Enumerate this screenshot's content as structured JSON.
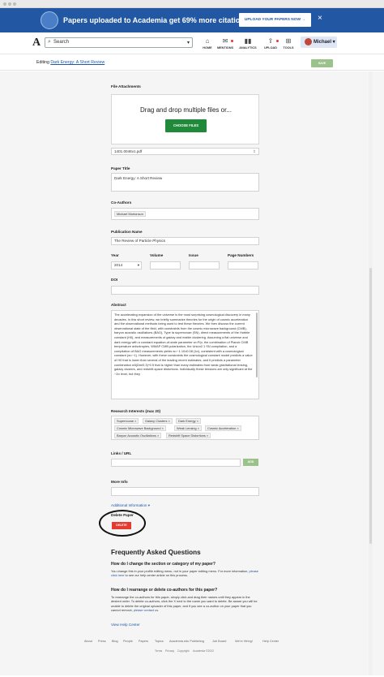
{
  "banner": {
    "message": "Papers uploaded to Academia get 69% more citations.",
    "upload_button": "UPLOAD YOUR PAPERS NOW →",
    "close": "×"
  },
  "nav": {
    "brand": "A",
    "search_placeholder": "Search",
    "items": [
      {
        "label": "HOME",
        "icon": "⌂"
      },
      {
        "label": "MENTIONS",
        "icon": "✉"
      },
      {
        "label": "ANALYTICS",
        "icon": "▮▮"
      },
      {
        "label": "UPLOAD",
        "icon": "⇪"
      },
      {
        "label": "TOOLS",
        "icon": "⊞"
      }
    ],
    "user": "Michael ▾"
  },
  "editbar": {
    "prefix": "Editing ",
    "paper_link": "Dark Energy: A Short Review",
    "save": "SAVE"
  },
  "form": {
    "file_attachments_label": "File Attachments",
    "dropzone_text": "Drag and drop multiple files or...",
    "choose_files": "CHOOSE FILES",
    "uploaded_file": "1401.0046v1.pdf",
    "paper_title_label": "Paper Title",
    "paper_title_value": "Dark Energy: A Short Review",
    "coauthors_label": "Co-Authors",
    "coauthor_value": "Michael Mortonson",
    "publication_label": "Publication Name",
    "publication_value": "The Review of Particle Physics",
    "year_label": "Year",
    "year_value": "2014",
    "volume_label": "Volume",
    "issue_label": "Issue",
    "pages_label": "Page Numbers",
    "doi_label": "DOI",
    "abstract_label": "Abstract",
    "abstract_text": "The accelerating expansion of the universe is the most surprising cosmological discovery in many decades. In this short review, we briefly summarize theories for the origin of cosmic acceleration and the observational methods being used to test these theories. We then discuss the current observational state of the field, with constraints from the cosmic microwave background (CMB), baryon acoustic oscillations (BAO), Type Ia supernovae (SN), direct measurements of the Hubble constant (H0), and measurements of galaxy and matter clustering. Assuming a flat universe and dark energy with a constant equation-of-state parameter w=P/ρ, the combination of Planck CMB temperature anisotropies, WMAP CMB polarization, the Union2.1 SN compilation, and a compilation of BAO measurements yields w=−1.10±0.08 (1σ), consistent with a cosmological constant (w=−1). However, with these constraints the cosmological constant model predicts a value of H0 that is lower than several of the leading recent estimates, and it predicts a parameter combination σ8(Ωm/0.3)^0.5 that is higher than many estimates from weak gravitational lensing, galaxy clusters, and redshift-space distortions. Individually these tensions are only significant at the ~2σ level, but they",
    "interests_label": "Research Interests (max 20)",
    "interests": [
      "Supernovae ×",
      "Galaxy Clusters ×",
      "Dark Energy ×",
      "Cosmic Microwave Background ×",
      "Weak Lensing ×",
      "Cosmic Acceleration ×",
      "Baryon Acoustic Oscillations ×",
      "Redshift Space Distortions ×"
    ],
    "links_label": "Links / URL",
    "add": "ADD",
    "more_info_label": "More Info",
    "additional_info": "Additional Information ▾",
    "delete_paper_label": "Delete Paper",
    "delete": "DELETE"
  },
  "faq": {
    "heading": "Frequently Asked Questions",
    "q1": "How do I change the section or category of my paper?",
    "a1_pre": "You change this in your profile editing menu, not in your paper editing menu. For more information, ",
    "a1_link": "please click here",
    "a1_post": " to see our help center article on this process.",
    "q2": "How do I rearrange or delete co-authors for this paper?",
    "a2_pre": "To rearrange the co-authors for this paper, simply click and drag their names until they appear in the desired order. To delete co-authors, click the X next to the name you want to delete. Be aware you will be unable to delete the original uploader of this paper, and if you see a co-author on your paper that you cannot remove, ",
    "a2_link": "please contact us",
    "a2_post": ".",
    "help_center": "View Help Center"
  },
  "footer": {
    "links": [
      "About",
      "Press",
      "Blog",
      "People",
      "Papers",
      "Topics",
      "Academia.edu Publishing",
      "Job Board",
      "We're Hiring!",
      "Help Center"
    ],
    "legal": [
      "Terms",
      "Privacy",
      "Copyright",
      "Academia ©2022"
    ]
  }
}
